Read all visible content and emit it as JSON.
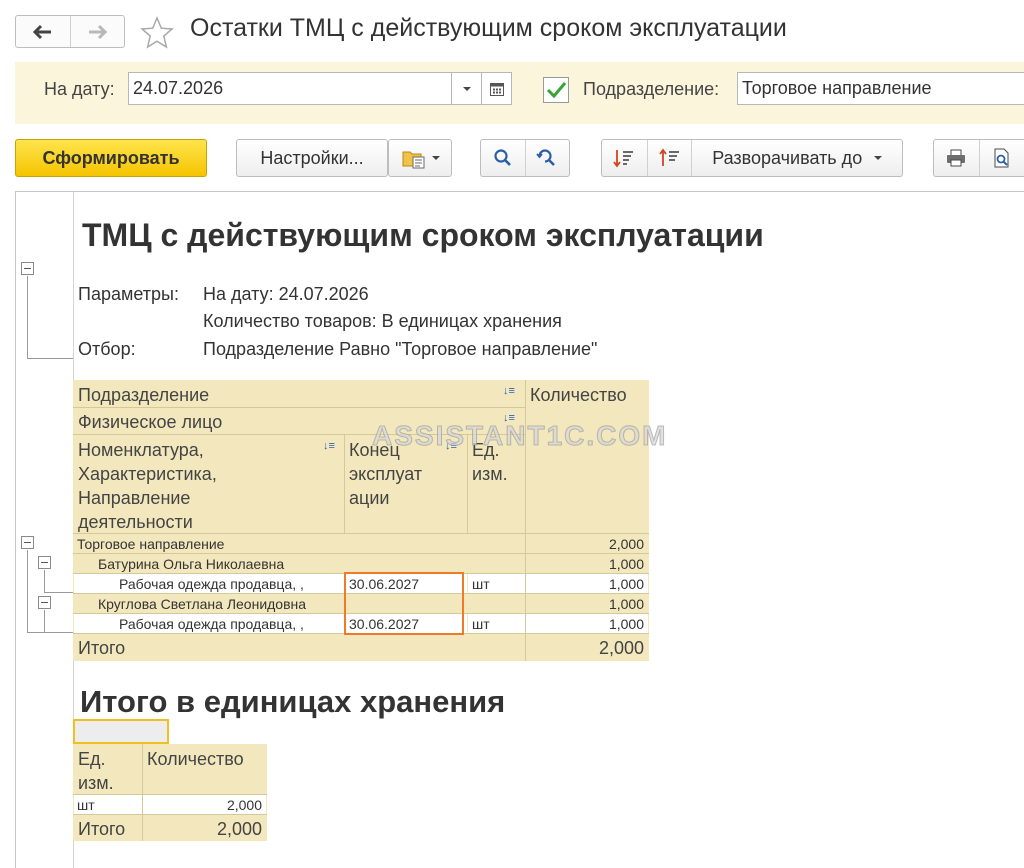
{
  "window": {
    "title": "Остатки ТМЦ с действующим сроком эксплуатации"
  },
  "params": {
    "date_label": "На дату:",
    "date_value": "24.07.2026",
    "division_checked": true,
    "division_label": "Подразделение:",
    "division_value": "Торговое направление"
  },
  "toolbar": {
    "generate": "Сформировать",
    "settings": "Настройки...",
    "expand_to": "Разворачивать до"
  },
  "report": {
    "title": "ТМЦ с действующим сроком эксплуатации",
    "params_label": "Параметры:",
    "param_lines": [
      "На дату: 24.07.2026",
      "Количество товаров: В единицах хранения"
    ],
    "filter_label": "Отбор:",
    "filter_value": "Подразделение Равно \"Торговое направление\"",
    "watermark": "ASSISTANT1C.COM",
    "headers": {
      "division": "Подразделение",
      "quantity": "Количество",
      "person": "Физическое лицо",
      "nomenclature": [
        "Номенклатура,",
        "Характеристика,",
        "Направление",
        "деятельности"
      ],
      "end": [
        "Конец",
        "эксплуат",
        "ации"
      ],
      "unit": [
        "Ед.",
        "изм."
      ]
    },
    "rows": [
      {
        "name": "Торговое направление",
        "end": "",
        "unit": "",
        "qty": "2,000"
      },
      {
        "name": "Батурина Ольга Николаевна",
        "end": "",
        "unit": "",
        "qty": "1,000"
      },
      {
        "name": "Рабочая одежда продавца, ,",
        "end": "30.06.2027",
        "unit": "шт",
        "qty": "1,000"
      },
      {
        "name": "Круглова Светлана Леонидовна",
        "end": "",
        "unit": "",
        "qty": "1,000"
      },
      {
        "name": "Рабочая одежда продавца, ,",
        "end": "30.06.2027",
        "unit": "шт",
        "qty": "1,000"
      }
    ],
    "total_label": "Итого",
    "total_qty": "2,000",
    "subtitle": "Итого в единицах хранения",
    "units_table": {
      "unit_header": [
        "Ед.",
        "изм."
      ],
      "qty_header": "Количество",
      "row_unit": "шт",
      "row_qty": "2,000",
      "total_label": "Итого",
      "total_qty": "2,000"
    }
  }
}
